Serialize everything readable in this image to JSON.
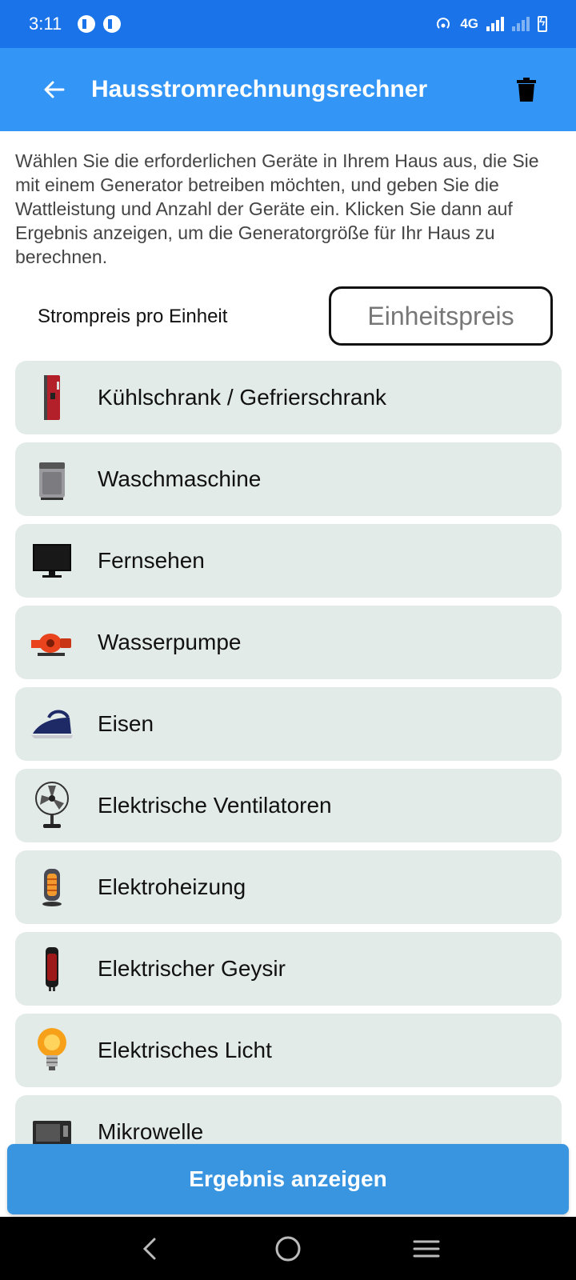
{
  "status_bar": {
    "time": "3:11",
    "network": "4G"
  },
  "app_bar": {
    "title": "Hausstromrechnungsrechner",
    "back_icon": "arrow-left-icon",
    "delete_icon": "trash-icon"
  },
  "intro_text": "Wählen Sie die erforderlichen Geräte in Ihrem Haus aus, die Sie mit einem Generator betreiben möchten, und geben Sie die Wattleistung und Anzahl der Geräte ein. Klicken Sie dann auf Ergebnis anzeigen, um die Generatorgröße für Ihr Haus zu berechnen.",
  "price": {
    "label": "Strompreis pro Einheit",
    "placeholder": "Einheitspreis",
    "value": ""
  },
  "appliances": [
    {
      "label": "Kühlschrank / Gefrierschrank",
      "icon": "refrigerator-icon"
    },
    {
      "label": "Waschmaschine",
      "icon": "washing-machine-icon"
    },
    {
      "label": "Fernsehen",
      "icon": "tv-icon"
    },
    {
      "label": "Wasserpumpe",
      "icon": "water-pump-icon"
    },
    {
      "label": "Eisen",
      "icon": "iron-icon"
    },
    {
      "label": "Elektrische Ventilatoren",
      "icon": "fan-icon"
    },
    {
      "label": "Elektroheizung",
      "icon": "heater-icon"
    },
    {
      "label": "Elektrischer Geysir",
      "icon": "geyser-icon"
    },
    {
      "label": "Elektrisches Licht",
      "icon": "light-bulb-icon"
    },
    {
      "label": "Mikrowelle",
      "icon": "microwave-icon"
    }
  ],
  "result_button": {
    "label": "Ergebnis anzeigen"
  },
  "colors": {
    "status_bar": "#1a73e8",
    "app_bar": "#3396f7",
    "list_item_bg": "#e3ebe8",
    "result_button": "#3a95e0"
  }
}
